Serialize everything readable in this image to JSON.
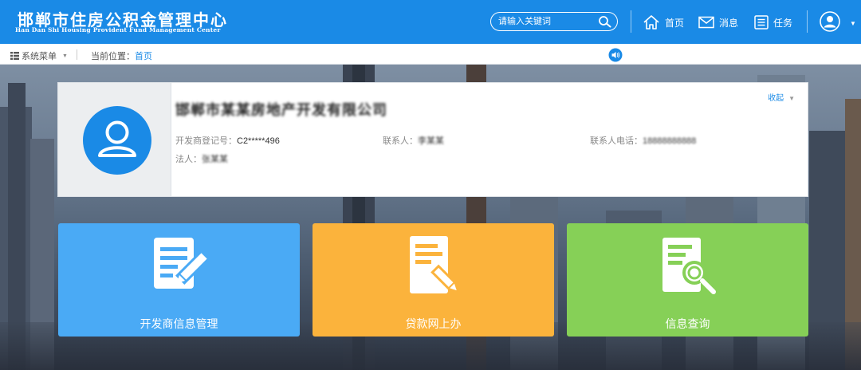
{
  "header": {
    "title": "邯郸市住房公积金管理中心",
    "subtitle": "Han Dan Shi Housing Provident Fund Management Center",
    "search_placeholder": "请输入关键词",
    "nav": {
      "home": "首页",
      "messages": "消息",
      "tasks": "任务"
    }
  },
  "subbar": {
    "menu_label": "系统菜单",
    "location_label": "当前位置：",
    "location_link": "首页"
  },
  "profile": {
    "company_name": "邯郸市某某房地产开发有限公司",
    "collapse_label": "收起",
    "fields": [
      {
        "label": "开发商登记号：",
        "value": "C2*****496",
        "blurred": false
      },
      {
        "label": "联系人：",
        "value": "李某某",
        "blurred": true
      },
      {
        "label": "联系人电话：",
        "value": "18888888888",
        "blurred": true
      },
      {
        "label": "法人：",
        "value": "张某某",
        "blurred": true
      }
    ]
  },
  "tiles": [
    {
      "label": "开发商信息管理",
      "color": "#4aaaf5",
      "icon": "edit-document-icon"
    },
    {
      "label": "贷款网上办",
      "color": "#fbb33c",
      "icon": "loan-document-icon"
    },
    {
      "label": "信息查询",
      "color": "#86d057",
      "icon": "search-document-icon"
    }
  ],
  "colors": {
    "header_bg": "#1a8ae6",
    "link": "#1a8ae6"
  }
}
